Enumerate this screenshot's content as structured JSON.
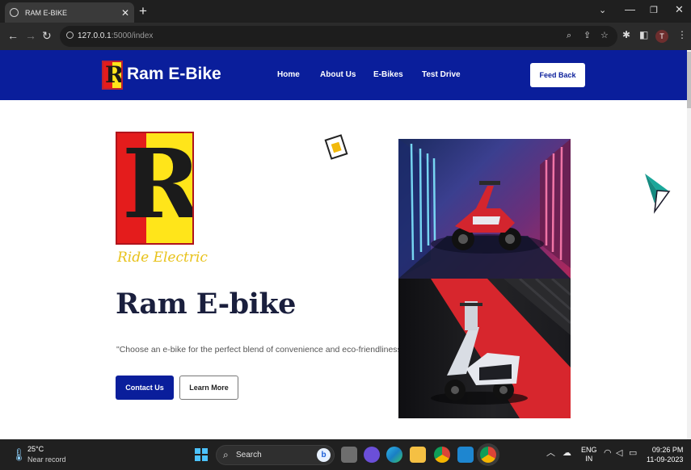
{
  "browser": {
    "tab_title": "RAM E-BIKE",
    "url_host": "127.0.0.1",
    "url_rest": ":5000/index",
    "profile_initial": "T"
  },
  "site": {
    "brand": "Ram E-Bike",
    "nav": [
      "Home",
      "About Us",
      "E-Bikes",
      "Test Drive"
    ],
    "feedback_label": "Feed Back",
    "logo_letter": "R"
  },
  "hero": {
    "logo_tagline": "Ride Electric",
    "headline": "Ram E-bike",
    "subtext": "\"Choose an e-bike for the perfect blend of convenience and eco-friendliness.\"",
    "contact_label": "Contact Us",
    "learn_label": "Learn More"
  },
  "taskbar": {
    "weather_temp": "25°C",
    "weather_desc": "Near record",
    "search_placeholder": "Search",
    "lang_line1": "ENG",
    "lang_line2": "IN",
    "time": "09:26 PM",
    "date": "11-09-2023"
  },
  "colors": {
    "brand_blue": "#0a1e9b",
    "logo_red": "#e41c1c",
    "logo_yellow": "#ffe51a",
    "arrow_teal": "#1aa79a"
  }
}
